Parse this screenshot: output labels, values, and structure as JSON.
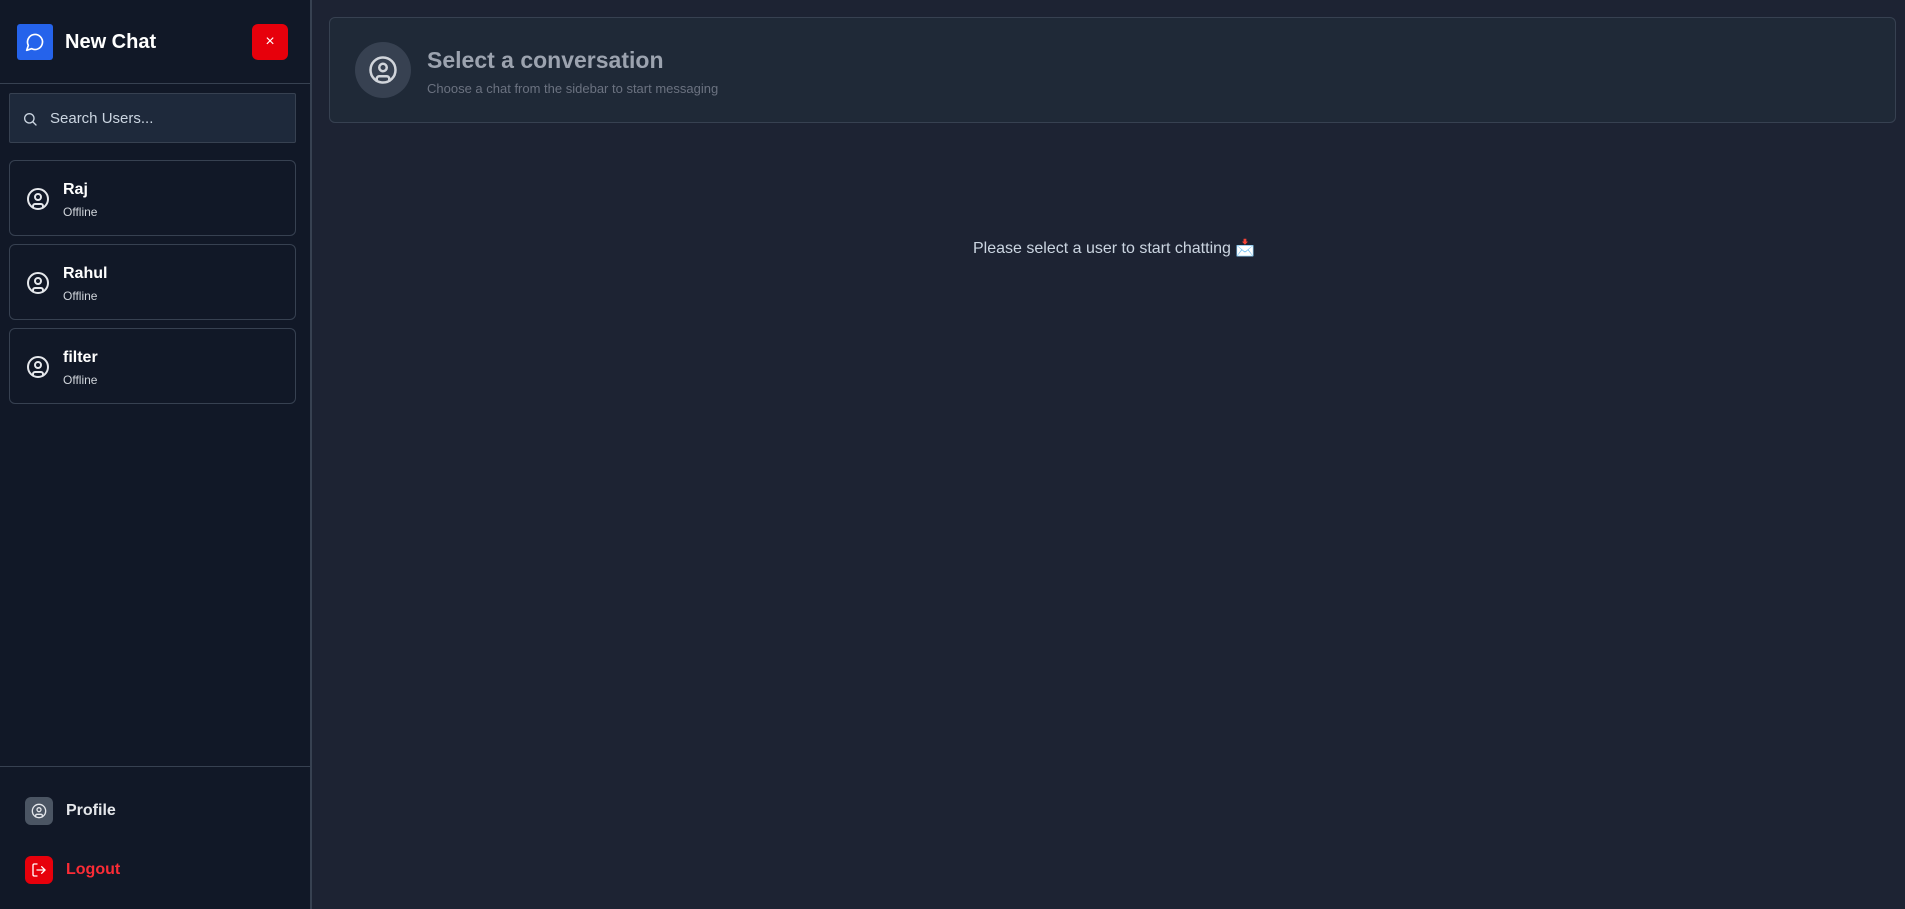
{
  "sidebar": {
    "brand": {
      "title": "New Chat",
      "icon": "chat-bubble-icon",
      "accent": "#2563eb"
    },
    "close_button": {
      "label": "×",
      "color": "#e7000b"
    },
    "search": {
      "placeholder": "Search Users...",
      "value": ""
    },
    "users": [
      {
        "name": "Raj",
        "status": "Offline"
      },
      {
        "name": "Rahul",
        "status": "Offline"
      },
      {
        "name": "filter",
        "status": "Offline"
      }
    ],
    "footer": {
      "profile_label": "Profile",
      "logout_label": "Logout"
    }
  },
  "main": {
    "header": {
      "title": "Select a conversation",
      "subtitle": "Choose a chat from the sidebar to start messaging"
    },
    "empty_message": "Please select a user to start chatting 📩"
  },
  "colors": {
    "sidebar_bg": "#111827",
    "main_bg": "#1d2333",
    "danger": "#e7000b"
  }
}
